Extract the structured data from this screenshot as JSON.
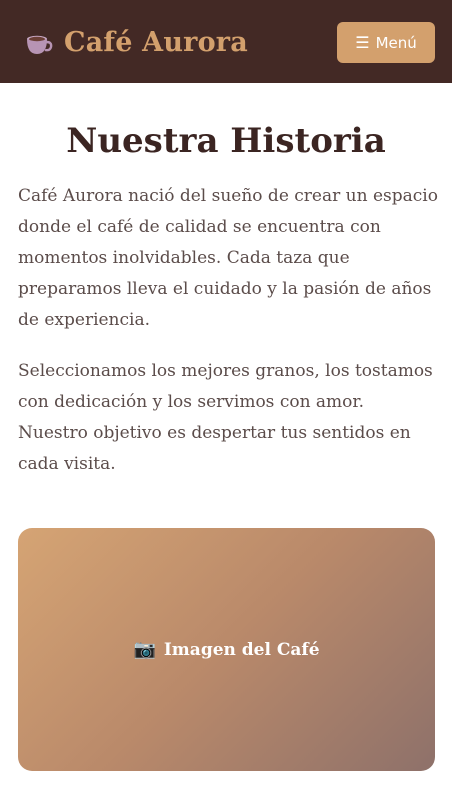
{
  "header": {
    "brand_title": "Café Aurora",
    "brand_icon": "coffee-cup-icon",
    "menu_label": "Menú",
    "menu_icon": "☰"
  },
  "main": {
    "title": "Nuestra Historia",
    "paragraphs": [
      "Café Aurora nació del sueño de crear un espacio donde el café de calidad se encuentra con momentos inolvidables. Cada taza que preparamos lleva el cuidado y la pasión de años de experiencia.",
      "Seleccionamos los mejores granos, los tostamos con dedicación y los servimos con amor. Nuestro objetivo es despertar tus sentidos en cada visita."
    ],
    "image_placeholder": {
      "icon": "📷",
      "label": "Imagen del Café"
    }
  },
  "colors": {
    "header_bg": "#432925",
    "accent": "#d3a06d",
    "title_text": "#3b2522",
    "body_text": "#5b4c4a",
    "image_gradient_start": "#d5a474",
    "image_gradient_end": "#8e716a"
  }
}
